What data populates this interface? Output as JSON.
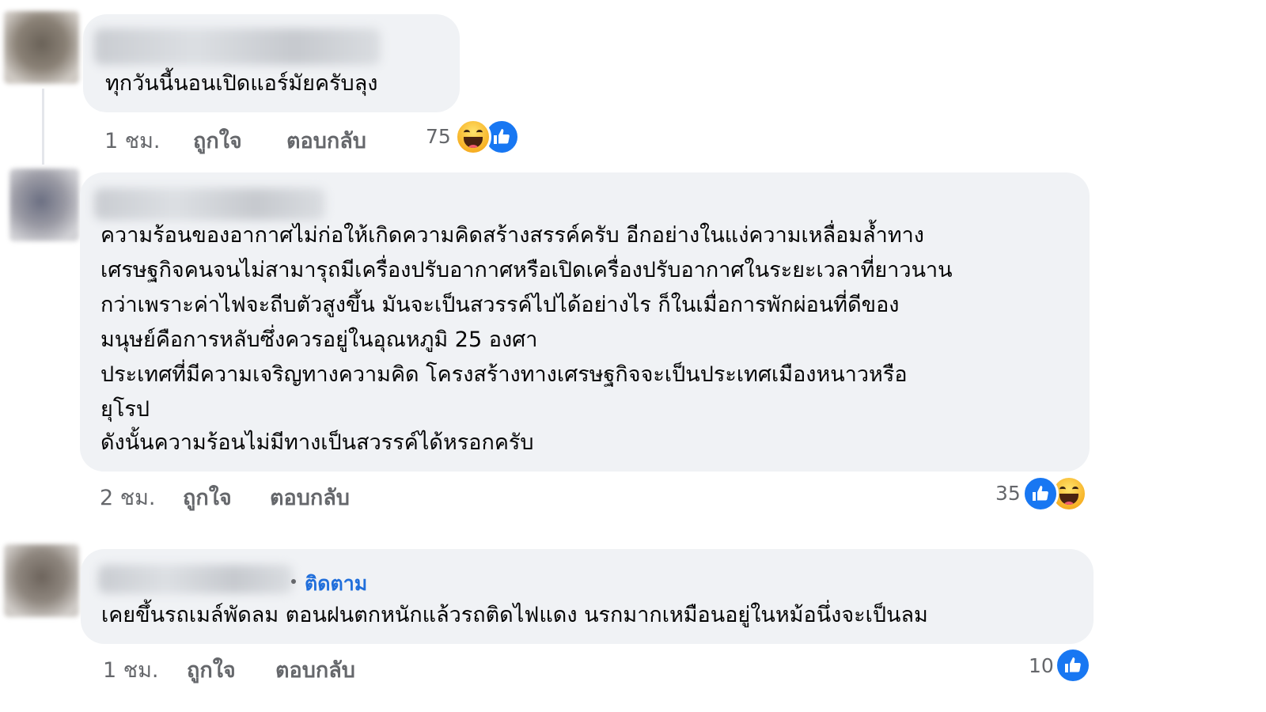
{
  "comments": [
    {
      "lines": [
        "ทุกวันนี้นอนเปิดแอร์มัยครับลุง"
      ],
      "time": "1 ชม.",
      "like_label": "ถูกใจ",
      "reply_label": "ตอบกลับ",
      "reaction_count": "75",
      "reactions": [
        "haha-icon",
        "like-icon"
      ]
    },
    {
      "lines": [
        "ความร้อนของอากาศไม่ก่อให้เกิดความคิดสร้างสรรค์ครับ อีกอย่างในแง่ความเหลื่อมล้ำทาง",
        "เศรษฐกิจคนจนไม่สามารุถมีเครื่องปรับอากาศหรือเปิดเครื่องปรับอากาศในระยะเวลาที่ยาวนาน",
        "กว่าเพราะค่าไฟจะถีบตัวสูงขึ้น มันจะเป็นสวรรค์ไปได้อย่างไร ก็ในเมื่อการพักผ่อนที่ดีของ",
        "มนุษย์คือการหลับซึ่งควรอยู่ในอุณหภูมิ 25 องศา",
        "ประเทศที่มีความเจริญทางความคิด โครงสร้างทางเศรษฐกิจจะเป็นประเทศเมืองหนาวหรือ",
        "ยุโรป",
        "ดังนั้นความร้อนไม่มีทางเป็นสวรรค์ได้หรอกครับ"
      ],
      "time": "2 ชม.",
      "like_label": "ถูกใจ",
      "reply_label": "ตอบกลับ",
      "reaction_count": "35",
      "reactions": [
        "like-icon",
        "haha-icon"
      ]
    },
    {
      "follow_label": "ติดตาม",
      "lines": [
        "เคยขึ้นรถเมล์พัดลม ตอนฝนตกหนักแล้วรถติดไฟแดง นรกมากเหมือนอยู่ในหม้อนึ่งจะเป็นลม"
      ],
      "time": "1 ชม.",
      "like_label": "ถูกใจ",
      "reply_label": "ตอบกลับ",
      "reaction_count": "10",
      "reactions": [
        "like-icon"
      ]
    }
  ],
  "colors": {
    "bubble": "#f0f2f5",
    "meta_text": "#65676b",
    "follow_link": "#216fdb",
    "like_blue": "#1877f2",
    "haha_yellow": "#f7b125"
  }
}
